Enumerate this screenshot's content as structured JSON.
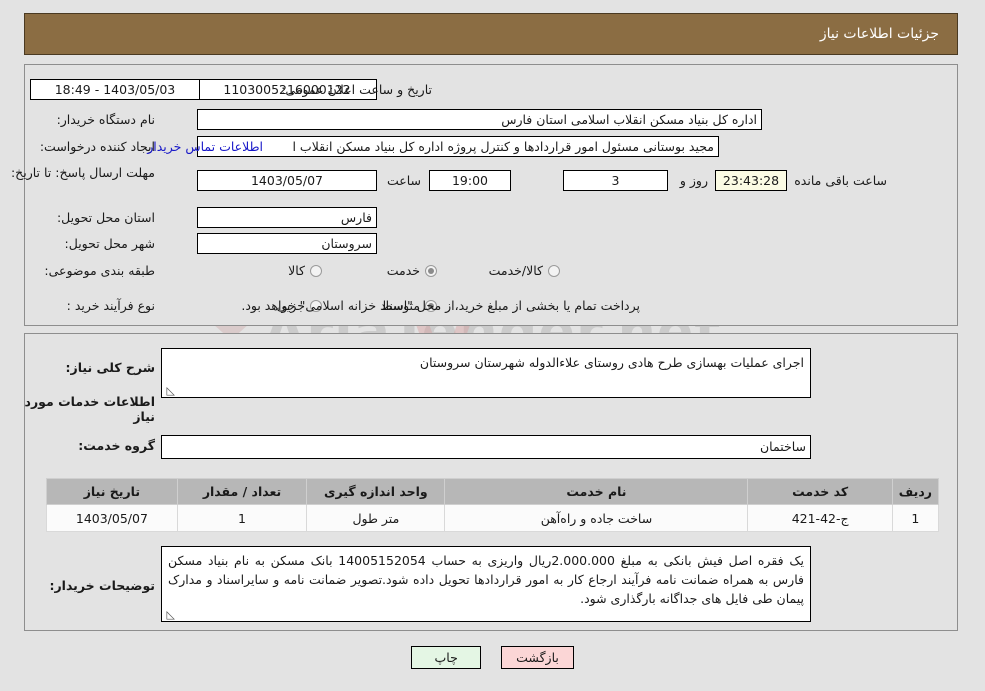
{
  "header": {
    "title": "جزئیات اطلاعات نیاز",
    "bar_color": "#8b6d43"
  },
  "watermark": {
    "text": "AriaTender.net"
  },
  "top_panel": {
    "need_number": {
      "label": "شماره نیاز:",
      "value": "1103005216000122"
    },
    "public_announce": {
      "label": "تاریخ و ساعت اعلان عمومی:",
      "value": "1403/05/03 - 18:49"
    },
    "buyer_org": {
      "label": "نام دستگاه خریدار:",
      "value": "اداره کل بنیاد مسکن انقلاب اسلامی استان فارس"
    },
    "requester": {
      "label": "ایجاد کننده درخواست:",
      "value": "مجید بوستانی مسئول امور قراردادها و کنترل پروژه اداره کل بنیاد مسکن انقلاب ا",
      "contact_link": "اطلاعات تماس خریدار"
    },
    "deadline": {
      "label": "مهلت ارسال پاسخ: تا تاریخ:",
      "date": "1403/05/07",
      "time_label": "ساعت",
      "time": "19:00",
      "days": "3",
      "days_label": "روز و",
      "countdown": "23:43:28",
      "countdown_label": "ساعت باقی مانده"
    },
    "province": {
      "label": "استان محل تحویل:",
      "value": "فارس"
    },
    "city": {
      "label": "شهر محل تحویل:",
      "value": "سروستان"
    },
    "category": {
      "label": "طبقه بندی موضوعی:",
      "options": [
        {
          "text": "کالا",
          "selected": false
        },
        {
          "text": "خدمت",
          "selected": true
        },
        {
          "text": "کالا/خدمت",
          "selected": false
        }
      ]
    },
    "purchase_type": {
      "label": "نوع فرآیند خرید :",
      "options": [
        {
          "text": "جزیی",
          "selected": false
        },
        {
          "text": "متوسط",
          "selected": true
        }
      ],
      "note": "پرداخت تمام یا بخشی از مبلغ خرید،از محل \"اسناد خزانه اسلامی\" خواهد بود."
    }
  },
  "bottom_panel": {
    "general_desc": {
      "label": "شرح کلی نیاز:",
      "value": "اجرای عملیات بهسازی طرح هادی روستای علاءالدوله شهرستان سروستان"
    },
    "section_heading": "اطلاعات خدمات مورد نیاز",
    "service_group": {
      "label": "گروه خدمت:",
      "value": "ساختمان"
    },
    "table": {
      "columns": [
        "ردیف",
        "کد خدمت",
        "نام خدمت",
        "واحد اندازه گیری",
        "تعداد / مقدار",
        "تاریخ نیاز"
      ],
      "rows": [
        [
          "1",
          "ج-42-421",
          "ساخت جاده و راه‌آهن",
          "متر طول",
          "1",
          "1403/05/07"
        ]
      ]
    },
    "buyer_notes": {
      "label": "توضیحات خریدار:",
      "value": "یک فقره اصل فیش بانکی به مبلغ 2.000.000ریال واریزی به حساب 14005152054 بانک مسکن به نام بنیاد مسکن فارس به همراه ضمانت نامه فرآیند ارجاع کار به امور قراردادها تحویل داده شود.تصویر ضمانت نامه و سایراسناد و مدارک پیمان طی فایل های جداگانه بارگذاری شود."
    }
  },
  "buttons": {
    "print": "چاپ",
    "back": "بازگشت"
  }
}
